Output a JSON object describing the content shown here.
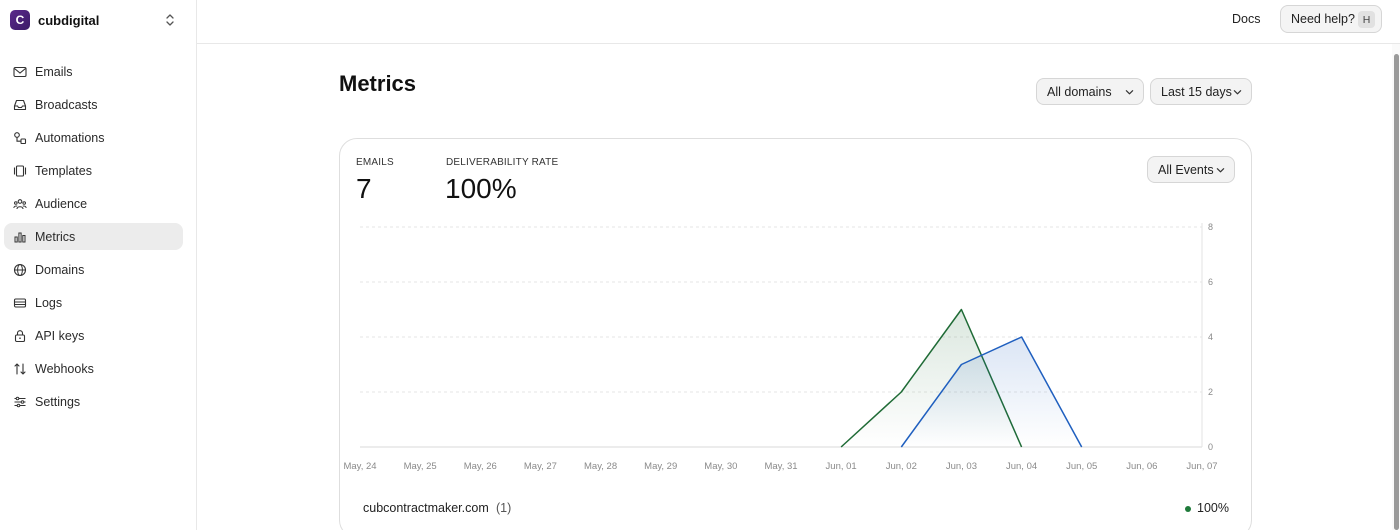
{
  "team": {
    "initial": "C",
    "name": "cubdigital"
  },
  "sidebar": {
    "items": [
      {
        "label": "Emails",
        "icon": "mail-icon"
      },
      {
        "label": "Broadcasts",
        "icon": "inbox-icon"
      },
      {
        "label": "Automations",
        "icon": "workflow-icon"
      },
      {
        "label": "Templates",
        "icon": "template-icon"
      },
      {
        "label": "Audience",
        "icon": "users-icon"
      },
      {
        "label": "Metrics",
        "icon": "bar-chart-icon",
        "active": true
      },
      {
        "label": "Domains",
        "icon": "globe-icon"
      },
      {
        "label": "Logs",
        "icon": "logs-icon"
      },
      {
        "label": "API keys",
        "icon": "lock-icon"
      },
      {
        "label": "Webhooks",
        "icon": "arrows-icon"
      },
      {
        "label": "Settings",
        "icon": "sliders-icon"
      }
    ]
  },
  "topbar": {
    "docs": "Docs",
    "help": "Need help?",
    "help_shortcut": "H"
  },
  "page": {
    "title": "Metrics",
    "domain_filter": "All domains",
    "range_filter": "Last 15 days"
  },
  "card": {
    "emails_label": "EMAILS",
    "emails_value": "7",
    "deliverability_label": "DELIVERABILITY RATE",
    "deliverability_value": "100%",
    "events_filter": "All Events"
  },
  "legend": {
    "domain": "cubcontractmaker.com",
    "count": "(1)",
    "rate": "100%"
  },
  "colors": {
    "green": "#1f6b36",
    "blue": "#1f5fbf",
    "accent_logo": "#4a2379"
  },
  "chart_data": {
    "type": "line",
    "categories": [
      "May, 24",
      "May, 25",
      "May, 26",
      "May, 27",
      "May, 28",
      "May, 29",
      "May, 30",
      "May, 31",
      "Jun, 01",
      "Jun, 02",
      "Jun, 03",
      "Jun, 04",
      "Jun, 05",
      "Jun, 06",
      "Jun, 07"
    ],
    "series": [
      {
        "color": "#1f6b36",
        "values": [
          0,
          0,
          0,
          0,
          0,
          0,
          0,
          0,
          0,
          2,
          5,
          0,
          0,
          0,
          0
        ]
      },
      {
        "color": "#1f5fbf",
        "values": [
          0,
          0,
          0,
          0,
          0,
          0,
          0,
          0,
          0,
          0,
          3,
          4,
          0,
          0,
          0
        ]
      }
    ],
    "yticks": [
      0,
      2,
      4,
      6,
      8
    ],
    "ylim": [
      0,
      8
    ],
    "y_axis_side": "right",
    "grid": true
  }
}
